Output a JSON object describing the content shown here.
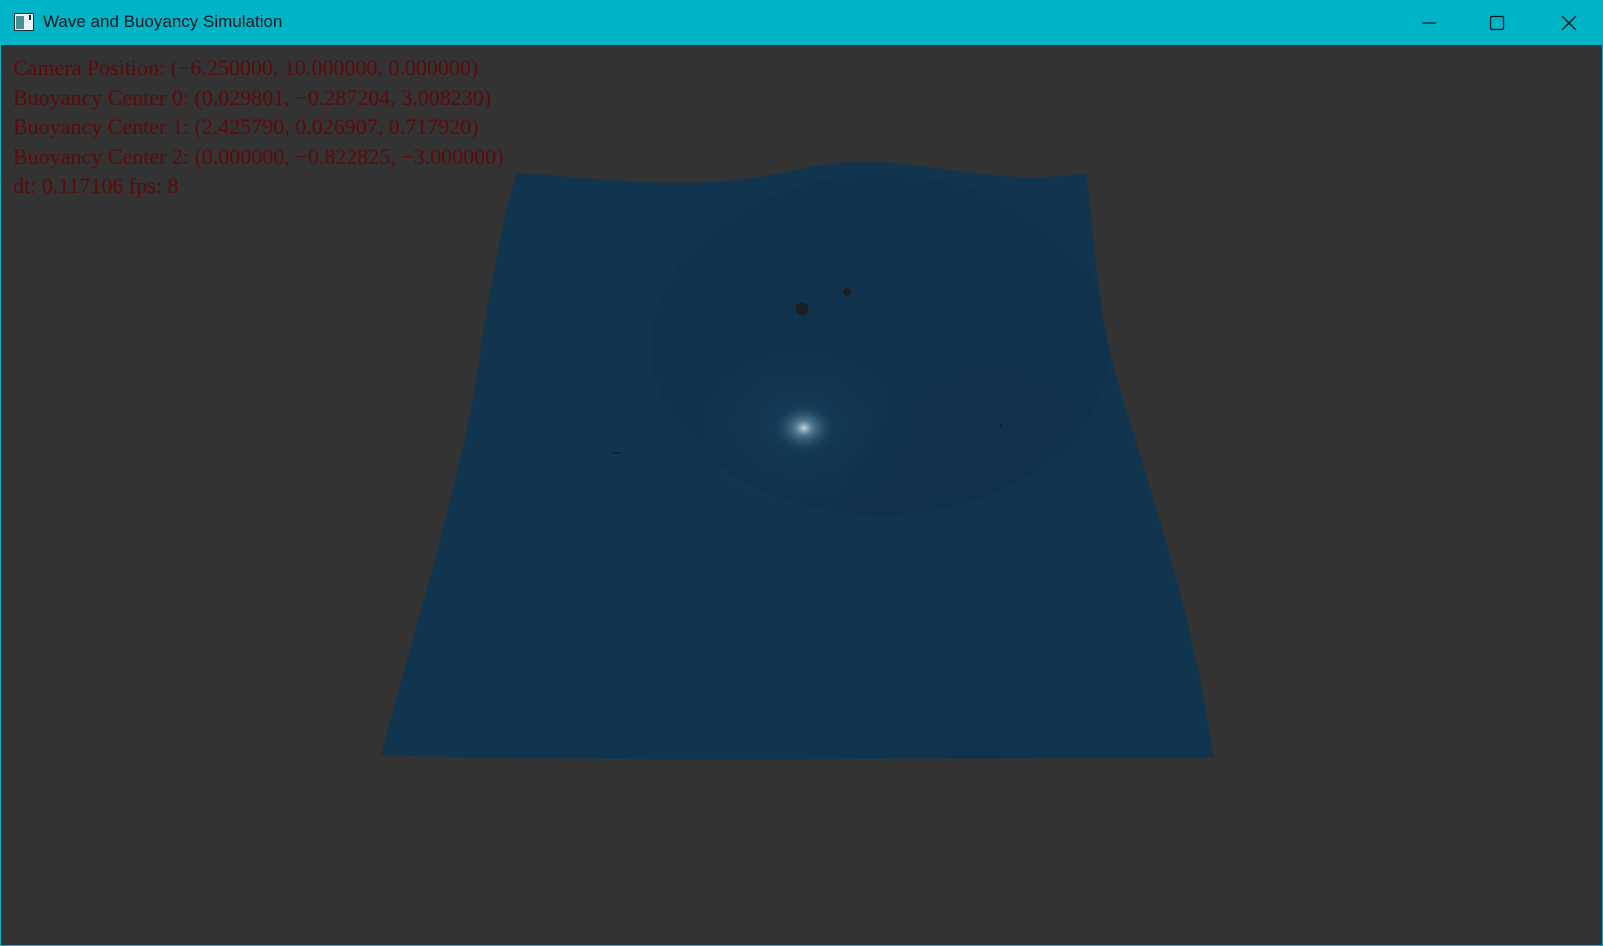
{
  "window": {
    "title": "Wave and Buoyancy Simulation",
    "icon": "app-window-icon",
    "controls": {
      "minimize": "minimize-icon",
      "maximize": "maximize-icon",
      "close": "close-icon"
    },
    "colors": {
      "titlebar": "#00B4C8",
      "background": "#333333",
      "water": "#12354F",
      "hud_text": "#5E0A0A"
    }
  },
  "hud": {
    "camera": "Camera Position: (−6.250000, 10.000000, 0.000000)",
    "buoyancy0": "Buoyancy Center 0: (0.029801, −0.287204, 3.008230)",
    "buoyancy1": "Buoyancy Center 1: (2.425790, 0.026907, 0.717920)",
    "buoyancy2": "Buoyancy Center 2: (0.000000, −0.822825, −3.000000)",
    "timing": "dt: 0.117106 fps: 8"
  }
}
